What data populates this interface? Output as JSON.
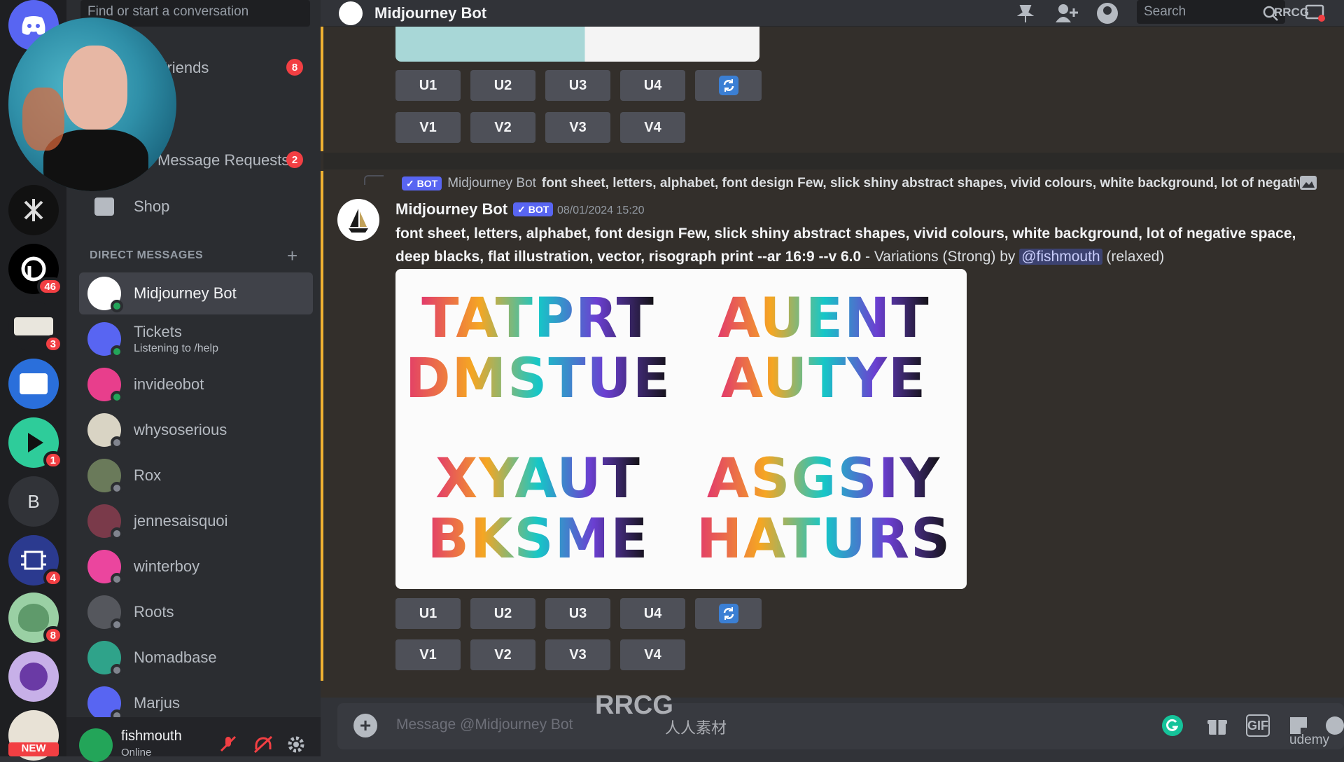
{
  "search": {
    "placeholder": "Find or start a conversation"
  },
  "nav": {
    "friends_label": "Friends",
    "friends_count": "8",
    "requests_label": "Message Requests",
    "requests_count": "2",
    "shop_label": "Shop"
  },
  "servers": [
    {
      "badge": ""
    },
    {
      "badge": ""
    },
    {
      "badge": "46"
    },
    {
      "badge": "3"
    },
    {
      "badge": ""
    },
    {
      "badge": "1"
    },
    {
      "letter": "B",
      "badge": ""
    },
    {
      "badge": "4"
    },
    {
      "badge": "8"
    },
    {
      "badge": ""
    },
    {
      "badge": "",
      "tag": "NEW"
    }
  ],
  "dm_section": {
    "title": "DIRECT MESSAGES",
    "add": "+"
  },
  "dms": [
    {
      "name": "Midjourney Bot",
      "sub": "",
      "color": "#ffffff",
      "online": true
    },
    {
      "name": "Tickets",
      "sub": "Listening to /help",
      "color": "#5865f2",
      "online": true
    },
    {
      "name": "invideobot",
      "sub": "",
      "color": "#e83e8c",
      "online": true
    },
    {
      "name": "whysoserious",
      "sub": "",
      "color": "#d9d4c4",
      "online": false
    },
    {
      "name": "Rox",
      "sub": "",
      "color": "#6a7a5a",
      "online": false
    },
    {
      "name": "jennesaisquoi",
      "sub": "",
      "color": "#7a3a4a",
      "online": false
    },
    {
      "name": "winterboy",
      "sub": "",
      "color": "#eb459e",
      "online": false
    },
    {
      "name": "Roots",
      "sub": "",
      "color": "#55575d",
      "online": false
    },
    {
      "name": "Nomadbase",
      "sub": "",
      "color": "#2fa38a",
      "online": false
    },
    {
      "name": "Marjus",
      "sub": "",
      "color": "#5865f2",
      "online": false
    }
  ],
  "user": {
    "name": "fishmouth",
    "status": "Online"
  },
  "header": {
    "title": "Midjourney Bot",
    "search_placeholder": "Search"
  },
  "buttons": {
    "upscale": [
      "U1",
      "U2",
      "U3",
      "U4"
    ],
    "variation": [
      "V1",
      "V2",
      "V3",
      "V4"
    ],
    "reroll_icon": "refresh-icon"
  },
  "message": {
    "reply_author": "Midjourney Bot",
    "reply_text": "font sheet, letters, alphabet, font design Few, slick shiny abstract shapes, vivid colours, white background, lot of negative",
    "author": "Midjourney Bot",
    "bot_tag": "BOT",
    "timestamp": "08/01/2024 15:20",
    "prompt": "font sheet, letters, alphabet, font design Few, slick shiny abstract shapes, vivid colours, white background, lot of negative space, deep blacks, flat illustration, vector, risograph print --ar 16:9 --v 6.0",
    "suffix_a": " - Variations (Strong) by ",
    "mention": "@fishmouth",
    "suffix_b": " (relaxed)"
  },
  "image_grid": [
    {
      "line1": "TATPRT",
      "line2": "DMSTUE"
    },
    {
      "line1": "AUENT",
      "line2": "AUTYE"
    },
    {
      "line1": "XYAUT",
      "line2": "BKSME"
    },
    {
      "line1": "ASGSIY",
      "line2": "HATURS"
    }
  ],
  "composer": {
    "placeholder": "Message @Midjourney Bot",
    "plus": "+",
    "gif_label": "GIF"
  },
  "watermark": {
    "main": "RRCG",
    "sub": "人人素材",
    "corner": "RRCG"
  },
  "udemy": "udemy",
  "colors": {
    "accent": "#5865f2",
    "online": "#23a559",
    "danger": "#f23f43",
    "highlight_bar": "#f0b232"
  }
}
